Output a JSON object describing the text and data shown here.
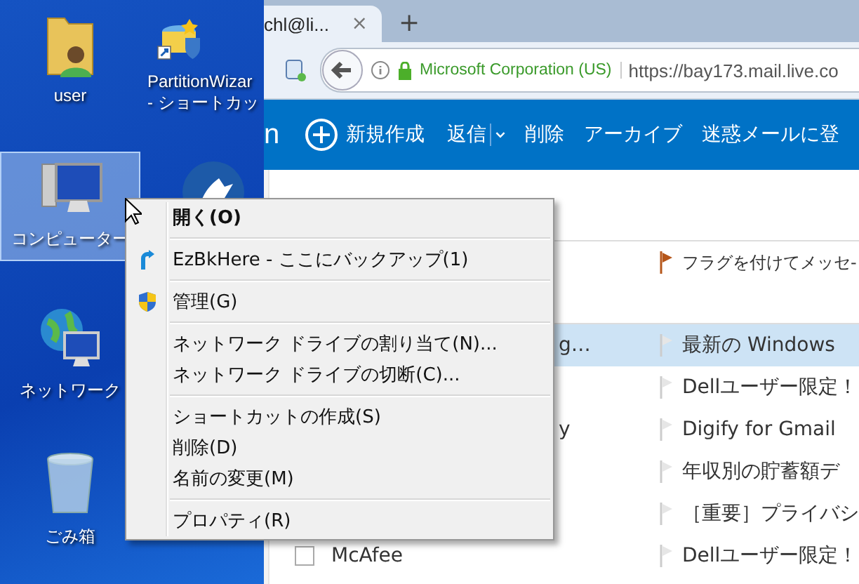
{
  "desktop": {
    "icons": [
      {
        "label": "user",
        "kind": "user-folder",
        "selected": false
      },
      {
        "label": "PartitionWizar\n- ショートカッ",
        "kind": "partition-tool",
        "selected": false
      },
      {
        "label": "コンピューター",
        "kind": "computer",
        "selected": true
      },
      {
        "kind": "bird-app",
        "selected": false
      },
      {
        "label": "ネットワーク",
        "kind": "network",
        "selected": false
      },
      {
        "label": "ごみ箱",
        "kind": "recycle-bin",
        "selected": false
      }
    ]
  },
  "browser": {
    "tab": {
      "title": "chl@li...",
      "close": "×"
    },
    "new_tab": "+",
    "identity": "Microsoft Corporation (US)",
    "url": "https://bay173.mail.live.co"
  },
  "mail": {
    "app_bar": {
      "brand_tail": "n",
      "new": "新規作成",
      "reply": "返信",
      "delete": "削除",
      "archive": "アーカイブ",
      "junk": "迷惑メールに登"
    },
    "rows": [
      {
        "kind": "notice",
        "subject": "フラグを付けてメッセ-",
        "flagged": true,
        "selected": false
      },
      {
        "kind": "partial",
        "sender": "g…",
        "subject": "最新の Windows",
        "flagged": false,
        "selected": true
      },
      {
        "kind": "message",
        "subject": "Dellユーザー限定！",
        "flagged": false,
        "selected": false
      },
      {
        "kind": "partial",
        "sender": "y",
        "subject": "Digify for Gmail",
        "flagged": false,
        "selected": false
      },
      {
        "kind": "message",
        "subject": "年収別の貯蓄額デ",
        "flagged": false,
        "selected": false
      },
      {
        "kind": "message",
        "subject": "［重要］プライバシ",
        "flagged": false,
        "selected": false
      },
      {
        "kind": "message",
        "sender": "McAfee",
        "subject": "Dellユーザー限定！",
        "flagged": false,
        "selected": false
      }
    ]
  },
  "context_menu": {
    "groups": [
      [
        {
          "label": "開く(O)",
          "default": true
        }
      ],
      [
        {
          "label": "EzBkHere - ここにバックアップ(1)",
          "kind": "backup",
          "default": false
        }
      ],
      [
        {
          "label": "管理(G)",
          "kind": "admin",
          "default": false
        }
      ],
      [
        {
          "label": "ネットワーク ドライブの割り当て(N)...",
          "default": false
        },
        {
          "label": "ネットワーク ドライブの切断(C)...",
          "default": false
        }
      ],
      [
        {
          "label": "ショートカットの作成(S)",
          "default": false
        },
        {
          "label": "削除(D)",
          "default": false
        },
        {
          "label": "名前の変更(M)",
          "default": false
        }
      ],
      [
        {
          "label": "プロパティ(R)",
          "default": false
        }
      ]
    ]
  }
}
